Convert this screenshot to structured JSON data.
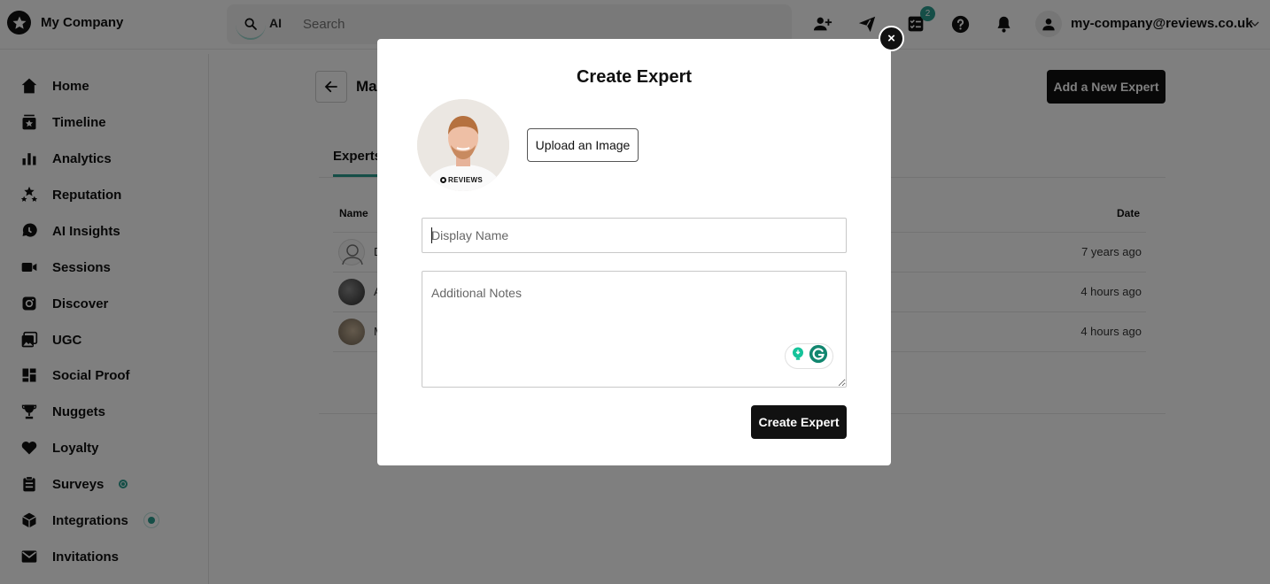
{
  "brand": {
    "name": "My Company"
  },
  "search": {
    "ai_label": "AI",
    "placeholder": "Search"
  },
  "topbar": {
    "notification_count": "2",
    "user_email": "my-company@reviews.co.uk"
  },
  "sidebar": {
    "items": [
      {
        "label": "Home",
        "icon": "home-icon"
      },
      {
        "label": "Timeline",
        "icon": "timeline-icon"
      },
      {
        "label": "Analytics",
        "icon": "analytics-icon"
      },
      {
        "label": "Reputation",
        "icon": "reputation-icon"
      },
      {
        "label": "AI Insights",
        "icon": "ai-insights-icon"
      },
      {
        "label": "Sessions",
        "icon": "video-icon"
      },
      {
        "label": "Discover",
        "icon": "discover-icon"
      },
      {
        "label": "UGC",
        "icon": "image-icon"
      },
      {
        "label": "Social Proof",
        "icon": "grid-icon"
      },
      {
        "label": "Nuggets",
        "icon": "trophy-icon"
      },
      {
        "label": "Loyalty",
        "icon": "heart-icon"
      },
      {
        "label": "Surveys",
        "icon": "clipboard-icon"
      },
      {
        "label": "Integrations",
        "icon": "cube-icon"
      },
      {
        "label": "Invitations",
        "icon": "envelope-icon"
      }
    ]
  },
  "page": {
    "title": "Ma",
    "add_button": "Add a New Expert",
    "tab": "Experts",
    "table": {
      "headers": {
        "name": "Name",
        "date": "Date"
      },
      "rows": [
        {
          "name": "D",
          "date": "7 years ago"
        },
        {
          "name": "A",
          "date": "4 hours ago"
        },
        {
          "name": "M",
          "date": "4 hours ago"
        }
      ]
    }
  },
  "modal": {
    "close_label": "×",
    "title": "Create Expert",
    "photo_caption": "REVIEWS",
    "upload_button": "Upload an Image",
    "display_name_placeholder": "Display Name",
    "notes_placeholder": "Additional Notes",
    "submit_button": "Create Expert"
  },
  "colors": {
    "accent": "#2a9d8f",
    "primary_button": "#111111",
    "overlay": "rgba(0,0,0,0.5)"
  }
}
